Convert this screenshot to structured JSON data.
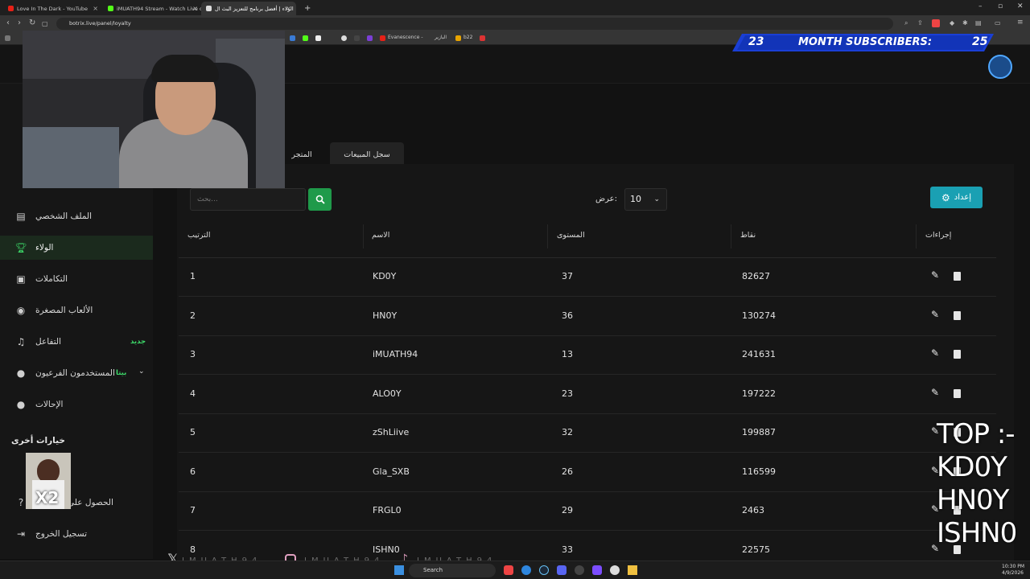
{
  "browser": {
    "tabs": [
      {
        "label": "Love In The Dark - YouTube",
        "active": false
      },
      {
        "label": "iMUATH94 Stream - Watch Live o",
        "active": false
      },
      {
        "label": "الولاء | أفضل برنامج للتعزيز البث ال",
        "active": true
      }
    ],
    "url": "botrix.live/panel/loyalty",
    "bookmarks": [
      "Evanescence -",
      "البازير",
      "b22"
    ]
  },
  "overlay": {
    "subs_left": "23",
    "subs_label": "MONTH SUBSCRIBERS:",
    "subs_right": "25",
    "top_title": "TOP :-",
    "top_names": [
      "KD0Y",
      "HN0Y",
      "ISHN0"
    ],
    "social_handle": "IMUATH94",
    "sticker_text": "X2"
  },
  "sidebar": {
    "items": [
      {
        "label": "الملف الشخصي",
        "icon": "id-card-icon",
        "active": false
      },
      {
        "label": "الولاء",
        "icon": "trophy-icon",
        "active": true
      },
      {
        "label": "التكاملات",
        "icon": "plug-icon",
        "active": false
      },
      {
        "label": "الألعاب المصغرة",
        "icon": "gamepad-icon",
        "active": false
      },
      {
        "label": "التفاعل",
        "icon": "music-icon",
        "active": false,
        "badge": "جديد"
      },
      {
        "label": "المستخدمون الفرعيون",
        "icon": "users-icon",
        "active": false,
        "badge": "بيتا"
      },
      {
        "label": "الإحالات",
        "icon": "user-group-icon",
        "active": false
      }
    ],
    "other_heading": "خيارات أخرى",
    "get_label": "الحصول على",
    "logout": "تسجيل الخروج"
  },
  "content": {
    "tabs": [
      "المتجر",
      "سجل المبيعات"
    ],
    "search_placeholder": "بحث...",
    "show_label": "عرض:",
    "show_value": "10",
    "settings_label": "إعداد",
    "columns": [
      "الترتيب",
      "الاسم",
      "المستوى",
      "نقاط",
      "إجراءات"
    ],
    "rows": [
      {
        "rank": "1",
        "name": "KD0Y",
        "level": "37",
        "points": "82627"
      },
      {
        "rank": "2",
        "name": "HN0Y",
        "level": "36",
        "points": "130274"
      },
      {
        "rank": "3",
        "name": "iMUATH94",
        "level": "13",
        "points": "241631"
      },
      {
        "rank": "4",
        "name": "ALO0Y",
        "level": "23",
        "points": "197222"
      },
      {
        "rank": "5",
        "name": "zShLiive",
        "level": "32",
        "points": "199887"
      },
      {
        "rank": "6",
        "name": "Gla_SXB",
        "level": "26",
        "points": "116599"
      },
      {
        "rank": "7",
        "name": "FRGL0",
        "level": "29",
        "points": "2463"
      },
      {
        "rank": "8",
        "name": "ISHN0",
        "level": "33",
        "points": "22575"
      }
    ]
  },
  "taskbar": {
    "search": "Search",
    "time": "10:30 PM",
    "date": "4/9/2026"
  },
  "colors": {
    "accent_green": "#1f9a4a",
    "accent_teal": "#1aa0b3",
    "banner_blue": "#1a3fd6"
  }
}
